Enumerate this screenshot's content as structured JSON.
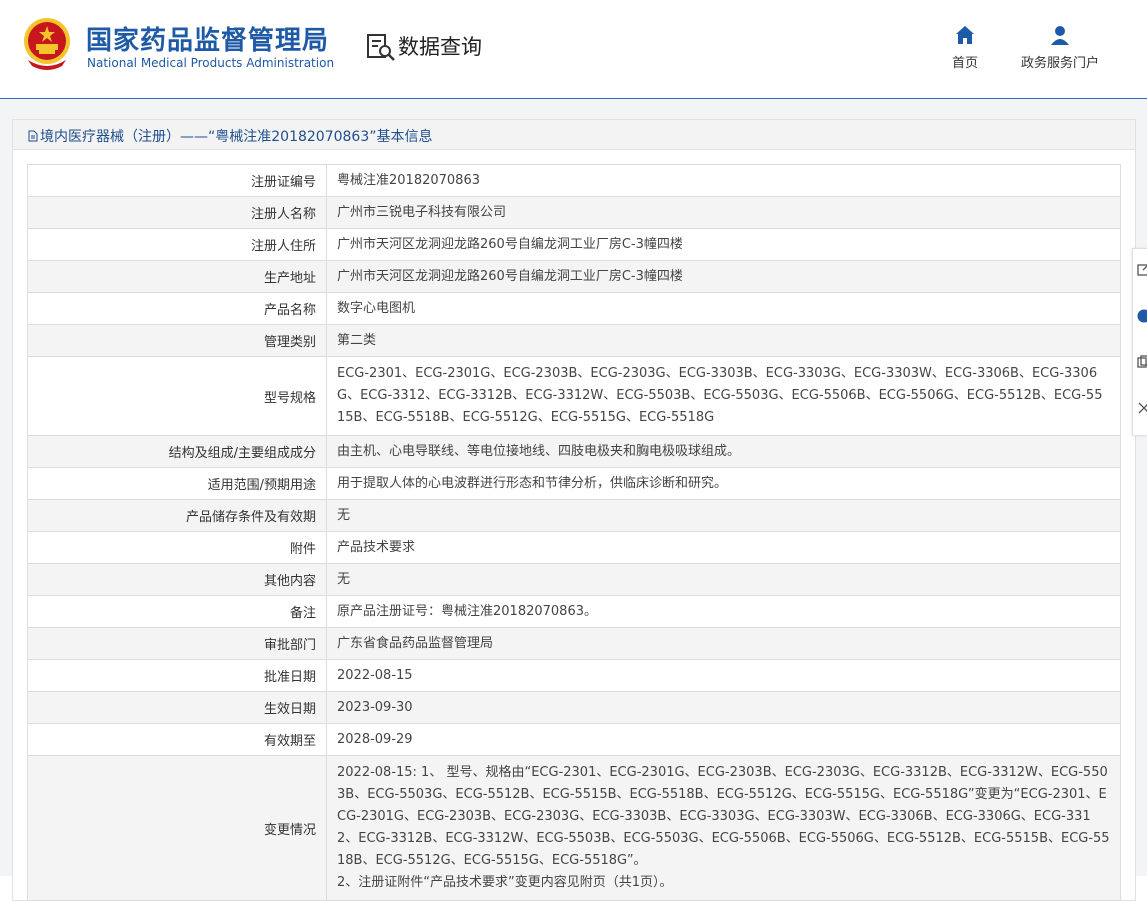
{
  "header": {
    "org_name_cn": "国家药品监督管理局",
    "org_name_en": "National Medical Products Administration",
    "section": "数据查询",
    "nav": [
      {
        "label": "首页",
        "icon": "home-icon"
      },
      {
        "label": "政务服务门户",
        "icon": "user-icon"
      }
    ]
  },
  "colors": {
    "brand": "#1f5aa6",
    "emblem_red": "#c8161d",
    "emblem_gold": "#f4c52b"
  },
  "panel": {
    "title": "境内医疗器械（注册）——“粤械注准20182070863”基本信息"
  },
  "table": {
    "rows": [
      {
        "label": "注册证编号",
        "value": "粤械注准20182070863"
      },
      {
        "label": "注册人名称",
        "value": "广州市三锐电子科技有限公司"
      },
      {
        "label": "注册人住所",
        "value": "广州市天河区龙洞迎龙路260号自编龙洞工业厂房C-3幢四楼"
      },
      {
        "label": "生产地址",
        "value": "广州市天河区龙洞迎龙路260号自编龙洞工业厂房C-3幢四楼"
      },
      {
        "label": "产品名称",
        "value": "数字心电图机"
      },
      {
        "label": "管理类别",
        "value": "第二类"
      },
      {
        "label": "型号规格",
        "value": "ECG-2301、ECG-2301G、ECG-2303B、ECG-2303G、ECG-3303B、ECG-3303G、ECG-3303W、ECG-3306B、ECG-3306G、ECG-3312、ECG-3312B、ECG-3312W、ECG-5503B、ECG-5503G、ECG-5506B、ECG-5506G、ECG-5512B、ECG-5515B、ECG-5518B、ECG-5512G、ECG-5515G、ECG-5518G"
      },
      {
        "label": "结构及组成/主要组成成分",
        "value": "由主机、心电导联线、等电位接地线、四肢电极夹和胸电极吸球组成。"
      },
      {
        "label": "适用范围/预期用途",
        "value": "用于提取人体的心电波群进行形态和节律分析，供临床诊断和研究。"
      },
      {
        "label": "产品储存条件及有效期",
        "value": "无"
      },
      {
        "label": "附件",
        "value": "产品技术要求"
      },
      {
        "label": "其他内容",
        "value": "无"
      },
      {
        "label": "备注",
        "value": "原产品注册证号：粤械注准20182070863。"
      },
      {
        "label": "审批部门",
        "value": "广东省食品药品监督管理局"
      },
      {
        "label": "批准日期",
        "value": "2022-08-15"
      },
      {
        "label": "生效日期",
        "value": "2023-09-30"
      },
      {
        "label": "有效期至",
        "value": "2028-09-29"
      },
      {
        "label": "变更情况",
        "value": "2022-08-15: 1、 型号、规格由“ECG-2301、ECG-2301G、ECG-2303B、ECG-2303G、ECG-3312B、ECG-3312W、ECG-5503B、ECG-5503G、ECG-5512B、ECG-5515B、ECG-5518B、ECG-5512G、ECG-5515G、ECG-5518G”变更为“ECG-2301、ECG-2301G、ECG-2303B、ECG-2303G、ECG-3303B、ECG-3303G、ECG-3303W、ECG-3306B、ECG-3306G、ECG-3312、ECG-3312B、ECG-3312W、ECG-5503B、ECG-5503G、ECG-5506B、ECG-5506G、ECG-5512B、ECG-5515B、ECG-5518B、ECG-5512G、ECG-5515G、ECG-5518G”。",
        "value2": "2、注册证附件“产品技术要求”变更内容见附页（共1页）。"
      }
    ]
  }
}
